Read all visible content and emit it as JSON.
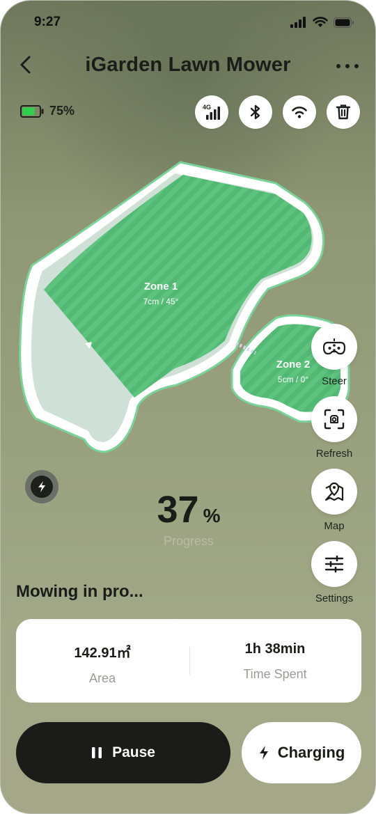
{
  "status_bar": {
    "time": "9:27"
  },
  "header": {
    "title": "iGarden Lawn Mower"
  },
  "battery": {
    "percent": "75%",
    "level": 0.75,
    "color": "#2fd14b"
  },
  "connectivity": {
    "icons": [
      "4g-signal-icon",
      "bluetooth-icon",
      "wifi-icon",
      "trash-icon"
    ],
    "network_label": "4G"
  },
  "map": {
    "zones": [
      {
        "name": "Zone 1",
        "settings": "7cm / 45°"
      },
      {
        "name": "Zone 2",
        "settings": "5cm / 0°"
      }
    ],
    "lawn_color": "#5ec37f",
    "mowed_color": "#cfe1d7"
  },
  "side_controls": [
    {
      "label": "Steer",
      "icon": "gamepad-icon"
    },
    {
      "label": "Refresh",
      "icon": "scan-icon"
    },
    {
      "label": "Map",
      "icon": "map-pin-icon"
    },
    {
      "label": "Settings",
      "icon": "sliders-icon"
    }
  ],
  "progress": {
    "value": "37",
    "unit": "%",
    "label": "Progress"
  },
  "status_text": "Mowing in pro...",
  "stats": [
    {
      "value": "142.91㎡",
      "label": "Area"
    },
    {
      "value": "1h 38min",
      "label": "Time Spent"
    }
  ],
  "actions": {
    "pause": "Pause",
    "charging": "Charging"
  }
}
